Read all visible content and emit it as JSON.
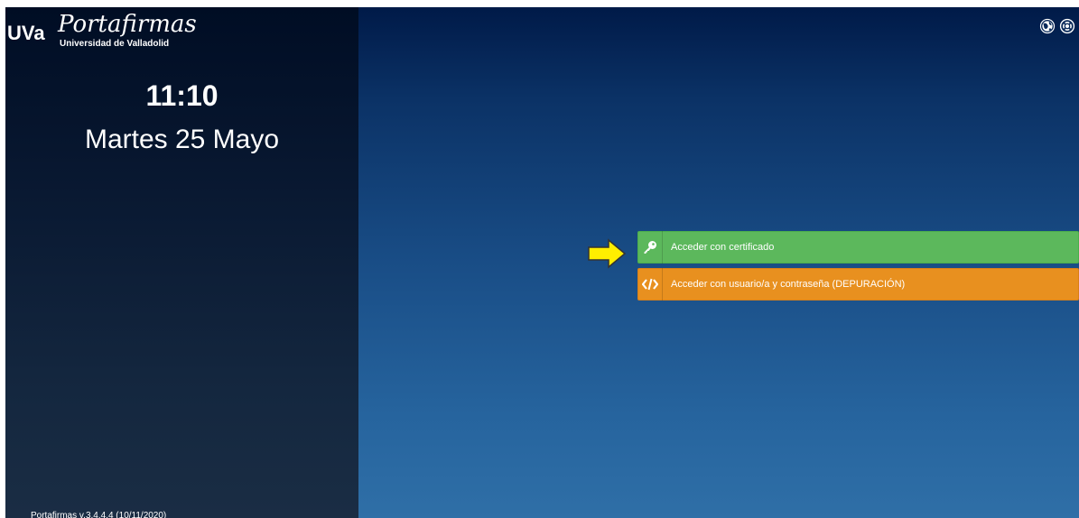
{
  "branding": {
    "uva": "UVa",
    "product": "Portafirmas",
    "university": "Universidad de Valladolid"
  },
  "clock": {
    "time": "11:10",
    "date": "Martes 25 Mayo"
  },
  "footer": {
    "version": "Portafirmas v.3.4.4.4 (10/11/2020)"
  },
  "top_icons": [
    {
      "icon": "language-globe-icon"
    },
    {
      "icon": "help-lifebuoy-icon"
    }
  ],
  "login": {
    "certificate_label": "Acceder con certificado",
    "certificate_icon": "key-icon",
    "certificate_color": "#5cb85c",
    "debug_label": "Acceder con usuario/a y contraseña (DEPURACIÓN)",
    "debug_icon": "code-icon",
    "debug_color": "#e8901f",
    "pointer_icon": "yellow-arrow-icon"
  }
}
